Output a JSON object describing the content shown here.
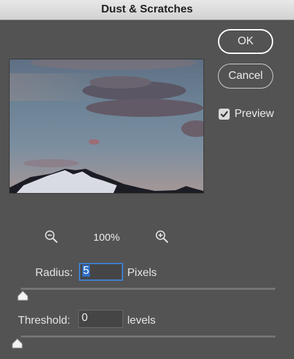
{
  "window": {
    "title": "Dust & Scratches"
  },
  "buttons": {
    "ok": "OK",
    "cancel": "Cancel"
  },
  "preview_toggle": {
    "label": "Preview",
    "checked": true
  },
  "zoom": {
    "level": "100%"
  },
  "radius": {
    "label": "Radius:",
    "value": "5",
    "unit": "Pixels"
  },
  "threshold": {
    "label": "Threshold:",
    "value": "0",
    "unit": "levels"
  },
  "colors": {
    "accent": "#3f7fcf",
    "background": "#535353"
  }
}
